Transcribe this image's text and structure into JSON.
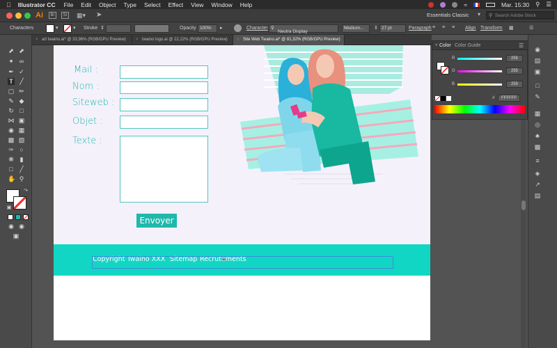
{
  "menubar": {
    "app_name": "Illustrator CC",
    "items": [
      "File",
      "Edit",
      "Object",
      "Type",
      "Select",
      "Effect",
      "View",
      "Window",
      "Help"
    ],
    "clock": "Mar. 15:30"
  },
  "appbar": {
    "logo": "Ai",
    "workspace": "Essentials Classic",
    "search_placeholder": "Search Adobe Stock",
    "colors": {
      "close": "#fc605c",
      "min": "#fdbc40",
      "max": "#34c84a",
      "logo": "#ff7c00"
    }
  },
  "control": {
    "characters": "Characters",
    "stroke": "Stroke",
    "opacity_label": "Opacity",
    "opacity_value": "100%",
    "character_label": "Character",
    "font": "Neutra Display",
    "weight": "Medium...",
    "size": "27 pt",
    "paragraph": "Paragraph",
    "align": "Align",
    "transform": "Transform"
  },
  "tabs": [
    {
      "label": "art twaino.ai* @ 33,96% (RGB/GPU Preview)",
      "active": false
    },
    {
      "label": "twaino logo.ai @ 22,22% (RGB/GPU Preview)",
      "active": false
    },
    {
      "label": "Site Web Twaino.ai* @ 81,32% (RGB/GPU Preview)",
      "active": true
    }
  ],
  "form": {
    "mail": "Mail :",
    "nom": "Nom :",
    "siteweb": "Siteweb :",
    "objet": "Objet :",
    "texte": "Texte :",
    "submit": "Envoyer"
  },
  "footer": {
    "copyright": "Copyright Twaino XXX",
    "sitemap": "Sitemap",
    "recrutements": "Recrutements"
  },
  "color_panel": {
    "tab_color": "Color",
    "tab_guide": "Color Guide",
    "r_label": "R",
    "g_label": "G",
    "b_label": "B",
    "r": "255",
    "g": "255",
    "b": "255",
    "hex_prefix": "#",
    "hex": "FFFFFF"
  },
  "theme": {
    "teal": "#12d6c4",
    "teal_dark": "#1fb6a8",
    "selection": "#3a8dd9"
  }
}
